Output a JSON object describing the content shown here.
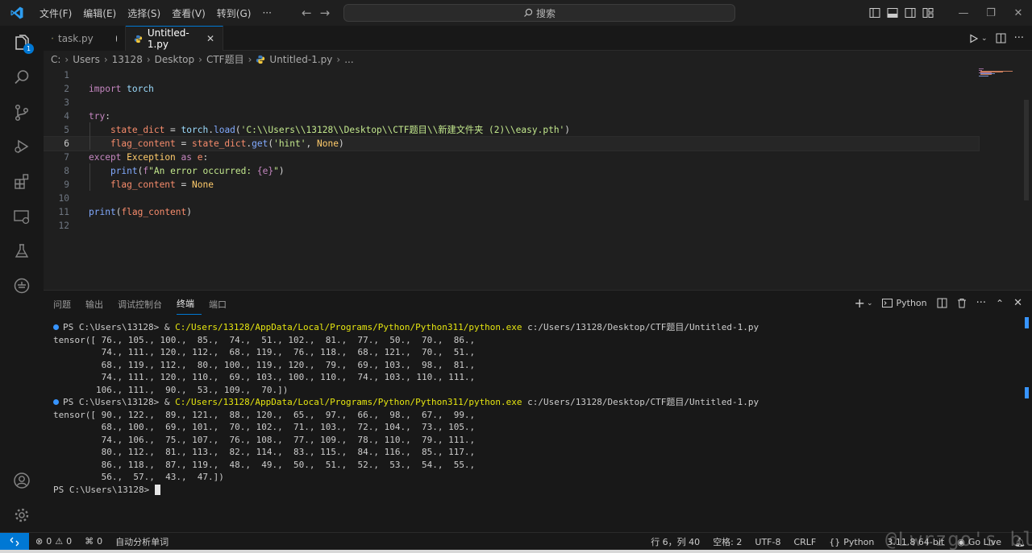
{
  "menu": [
    "文件(F)",
    "编辑(E)",
    "选择(S)",
    "查看(V)",
    "转到(G)",
    "···"
  ],
  "search_label": "搜索",
  "activity_badge": "1",
  "tabs": [
    {
      "label": "task.py"
    },
    {
      "label": "Untitled-1.py"
    }
  ],
  "breadcrumb": [
    "C:",
    "Users",
    "13128",
    "Desktop",
    "CTF题目",
    "Untitled-1.py",
    "..."
  ],
  "code_lines": [
    {
      "n": "1",
      "segments": []
    },
    {
      "n": "2",
      "segments": [
        [
          "kw",
          "import"
        ],
        [
          "plain",
          " "
        ],
        [
          "mod",
          "torch"
        ]
      ]
    },
    {
      "n": "3",
      "segments": []
    },
    {
      "n": "4",
      "segments": [
        [
          "kw",
          "try"
        ],
        [
          "plain",
          ":"
        ]
      ]
    },
    {
      "n": "5",
      "segments": [
        [
          "plain",
          "    "
        ],
        [
          "var",
          "state_dict"
        ],
        [
          "plain",
          " = "
        ],
        [
          "mod",
          "torch"
        ],
        [
          "plain",
          "."
        ],
        [
          "fn",
          "load"
        ],
        [
          "plain",
          "("
        ],
        [
          "str",
          "'C:\\\\Users\\\\13128\\\\Desktop\\\\CTF题目\\\\新建文件夹 (2)\\\\easy.pth'"
        ],
        [
          "plain",
          ")"
        ]
      ]
    },
    {
      "n": "6",
      "segments": [
        [
          "plain",
          "    "
        ],
        [
          "var",
          "flag_content"
        ],
        [
          "plain",
          " = "
        ],
        [
          "var",
          "state_dict"
        ],
        [
          "plain",
          "."
        ],
        [
          "fn",
          "get"
        ],
        [
          "plain",
          "("
        ],
        [
          "str",
          "'hint'"
        ],
        [
          "plain",
          ", "
        ],
        [
          "cls",
          "None"
        ],
        [
          "plain",
          ")"
        ]
      ]
    },
    {
      "n": "7",
      "segments": [
        [
          "kw",
          "except"
        ],
        [
          "plain",
          " "
        ],
        [
          "cls",
          "Exception"
        ],
        [
          "plain",
          " "
        ],
        [
          "kw",
          "as"
        ],
        [
          "plain",
          " "
        ],
        [
          "var",
          "e"
        ],
        [
          "plain",
          ":"
        ]
      ]
    },
    {
      "n": "8",
      "segments": [
        [
          "plain",
          "    "
        ],
        [
          "fn",
          "print"
        ],
        [
          "plain",
          "("
        ],
        [
          "kw",
          "f"
        ],
        [
          "str",
          "\"An error occurred: "
        ],
        [
          "kw",
          "{e}"
        ],
        [
          "str",
          "\""
        ],
        [
          "plain",
          ")"
        ]
      ]
    },
    {
      "n": "9",
      "segments": [
        [
          "plain",
          "    "
        ],
        [
          "var",
          "flag_content"
        ],
        [
          "plain",
          " = "
        ],
        [
          "cls",
          "None"
        ]
      ]
    },
    {
      "n": "10",
      "segments": []
    },
    {
      "n": "11",
      "segments": [
        [
          "fn",
          "print"
        ],
        [
          "plain",
          "("
        ],
        [
          "var",
          "flag_content"
        ],
        [
          "plain",
          ")"
        ]
      ]
    },
    {
      "n": "12",
      "segments": []
    }
  ],
  "panel_tabs": [
    "问题",
    "输出",
    "调试控制台",
    "终端",
    "端口"
  ],
  "terminal_profile": "Python",
  "terminal": [
    {
      "type": "cmd",
      "prompt": "PS C:\\Users\\13128> & ",
      "exe": "C:/Users/13128/AppData/Local/Programs/Python/Python311/python.exe",
      "arg": " c:/Users/13128/Desktop/CTF题目/Untitled-1.py"
    },
    {
      "type": "out",
      "text": "tensor([ 76., 105., 100.,  85.,  74.,  51., 102.,  81.,  77.,  50.,  70.,  86.,"
    },
    {
      "type": "out",
      "text": "         74., 111., 120., 112.,  68., 119.,  76., 118.,  68., 121.,  70.,  51.,"
    },
    {
      "type": "out",
      "text": "         68., 119., 112.,  80., 100., 119., 120.,  79.,  69., 103.,  98.,  81.,"
    },
    {
      "type": "out",
      "text": "         74., 111., 120., 110.,  69., 103., 100., 110.,  74., 103., 110., 111.,"
    },
    {
      "type": "out",
      "text": "        106., 111.,  90.,  53., 109.,  70.])"
    },
    {
      "type": "cmd",
      "prompt": "PS C:\\Users\\13128> & ",
      "exe": "C:/Users/13128/AppData/Local/Programs/Python/Python311/python.exe",
      "arg": " c:/Users/13128/Desktop/CTF题目/Untitled-1.py"
    },
    {
      "type": "out",
      "text": "tensor([ 90., 122.,  89., 121.,  88., 120.,  65.,  97.,  66.,  98.,  67.,  99.,"
    },
    {
      "type": "out",
      "text": "         68., 100.,  69., 101.,  70., 102.,  71., 103.,  72., 104.,  73., 105.,"
    },
    {
      "type": "out",
      "text": "         74., 106.,  75., 107.,  76., 108.,  77., 109.,  78., 110.,  79., 111.,"
    },
    {
      "type": "out",
      "text": "         80., 112.,  81., 113.,  82., 114.,  83., 115.,  84., 116.,  85., 117.,"
    },
    {
      "type": "out",
      "text": "         86., 118.,  87., 119.,  48.,  49.,  50.,  51.,  52.,  53.,  54.,  55.,"
    },
    {
      "type": "out",
      "text": "         56.,  57.,  43.,  47.])"
    },
    {
      "type": "prompt",
      "text": "PS C:\\Users\\13128> "
    }
  ],
  "status": {
    "errors": "0",
    "warnings": "0",
    "ports": "0",
    "analysis": "自动分析单词",
    "position": "行 6，列 40",
    "spaces": "空格: 2",
    "encoding": "UTF-8",
    "eol": "CRLF",
    "language": "Python",
    "interpreter": "3.11.8 64-bit",
    "golive": "Go Live"
  },
  "watermark": "@Lwrzgo's blog",
  "colors": {
    "accent": "#0078d4",
    "keyword": "#c586c0",
    "variable": "#f78c6c",
    "function": "#82aaff",
    "string": "#c3e88d",
    "exe_path": "#e5e510"
  }
}
